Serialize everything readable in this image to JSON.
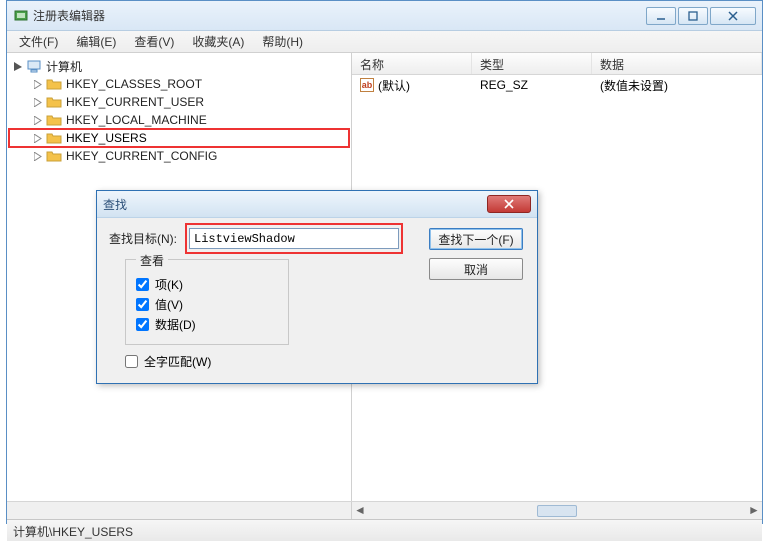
{
  "window": {
    "title": "注册表编辑器"
  },
  "menu": {
    "file": "文件(F)",
    "edit": "编辑(E)",
    "view": "查看(V)",
    "favorites": "收藏夹(A)",
    "help": "帮助(H)"
  },
  "tree": {
    "root": "计算机",
    "items": [
      "HKEY_CLASSES_ROOT",
      "HKEY_CURRENT_USER",
      "HKEY_LOCAL_MACHINE",
      "HKEY_USERS",
      "HKEY_CURRENT_CONFIG"
    ],
    "selected_index": 3
  },
  "list": {
    "columns": {
      "name": "名称",
      "type": "类型",
      "data": "数据"
    },
    "rows": [
      {
        "name": "(默认)",
        "type": "REG_SZ",
        "data": "(数值未设置)"
      }
    ]
  },
  "statusbar": {
    "path": "计算机\\HKEY_USERS"
  },
  "find_dialog": {
    "title": "查找",
    "label_target": "查找目标(N):",
    "input_value": "ListviewShadow",
    "group_title": "查看",
    "chk_keys": "项(K)",
    "chk_values": "值(V)",
    "chk_data": "数据(D)",
    "chk_match": "全字匹配(W)",
    "btn_find_next": "查找下一个(F)",
    "btn_cancel": "取消"
  }
}
